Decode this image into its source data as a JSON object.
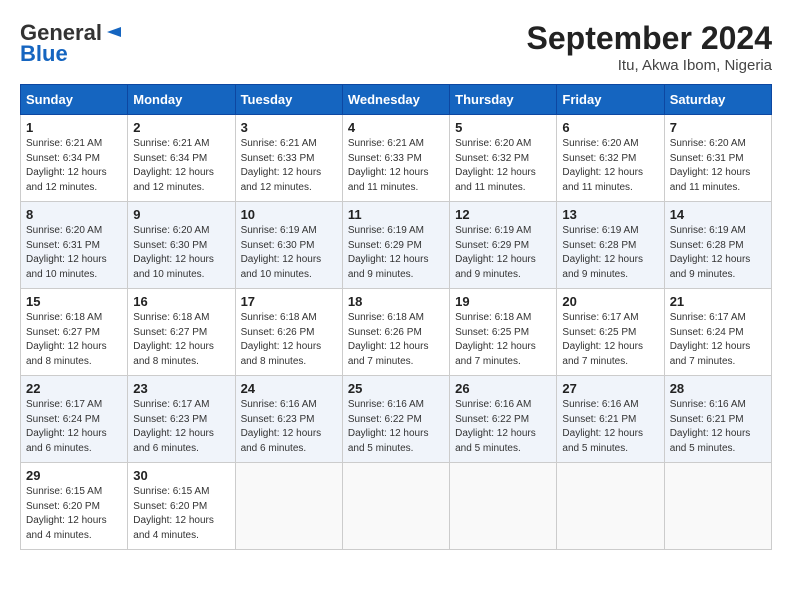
{
  "logo": {
    "line1": "General",
    "line2": "Blue"
  },
  "title": "September 2024",
  "location": "Itu, Akwa Ibom, Nigeria",
  "days_of_week": [
    "Sunday",
    "Monday",
    "Tuesday",
    "Wednesday",
    "Thursday",
    "Friday",
    "Saturday"
  ],
  "weeks": [
    [
      {
        "day": "1",
        "info": "Sunrise: 6:21 AM\nSunset: 6:34 PM\nDaylight: 12 hours\nand 12 minutes."
      },
      {
        "day": "2",
        "info": "Sunrise: 6:21 AM\nSunset: 6:34 PM\nDaylight: 12 hours\nand 12 minutes."
      },
      {
        "day": "3",
        "info": "Sunrise: 6:21 AM\nSunset: 6:33 PM\nDaylight: 12 hours\nand 12 minutes."
      },
      {
        "day": "4",
        "info": "Sunrise: 6:21 AM\nSunset: 6:33 PM\nDaylight: 12 hours\nand 11 minutes."
      },
      {
        "day": "5",
        "info": "Sunrise: 6:20 AM\nSunset: 6:32 PM\nDaylight: 12 hours\nand 11 minutes."
      },
      {
        "day": "6",
        "info": "Sunrise: 6:20 AM\nSunset: 6:32 PM\nDaylight: 12 hours\nand 11 minutes."
      },
      {
        "day": "7",
        "info": "Sunrise: 6:20 AM\nSunset: 6:31 PM\nDaylight: 12 hours\nand 11 minutes."
      }
    ],
    [
      {
        "day": "8",
        "info": "Sunrise: 6:20 AM\nSunset: 6:31 PM\nDaylight: 12 hours\nand 10 minutes."
      },
      {
        "day": "9",
        "info": "Sunrise: 6:20 AM\nSunset: 6:30 PM\nDaylight: 12 hours\nand 10 minutes."
      },
      {
        "day": "10",
        "info": "Sunrise: 6:19 AM\nSunset: 6:30 PM\nDaylight: 12 hours\nand 10 minutes."
      },
      {
        "day": "11",
        "info": "Sunrise: 6:19 AM\nSunset: 6:29 PM\nDaylight: 12 hours\nand 9 minutes."
      },
      {
        "day": "12",
        "info": "Sunrise: 6:19 AM\nSunset: 6:29 PM\nDaylight: 12 hours\nand 9 minutes."
      },
      {
        "day": "13",
        "info": "Sunrise: 6:19 AM\nSunset: 6:28 PM\nDaylight: 12 hours\nand 9 minutes."
      },
      {
        "day": "14",
        "info": "Sunrise: 6:19 AM\nSunset: 6:28 PM\nDaylight: 12 hours\nand 9 minutes."
      }
    ],
    [
      {
        "day": "15",
        "info": "Sunrise: 6:18 AM\nSunset: 6:27 PM\nDaylight: 12 hours\nand 8 minutes."
      },
      {
        "day": "16",
        "info": "Sunrise: 6:18 AM\nSunset: 6:27 PM\nDaylight: 12 hours\nand 8 minutes."
      },
      {
        "day": "17",
        "info": "Sunrise: 6:18 AM\nSunset: 6:26 PM\nDaylight: 12 hours\nand 8 minutes."
      },
      {
        "day": "18",
        "info": "Sunrise: 6:18 AM\nSunset: 6:26 PM\nDaylight: 12 hours\nand 7 minutes."
      },
      {
        "day": "19",
        "info": "Sunrise: 6:18 AM\nSunset: 6:25 PM\nDaylight: 12 hours\nand 7 minutes."
      },
      {
        "day": "20",
        "info": "Sunrise: 6:17 AM\nSunset: 6:25 PM\nDaylight: 12 hours\nand 7 minutes."
      },
      {
        "day": "21",
        "info": "Sunrise: 6:17 AM\nSunset: 6:24 PM\nDaylight: 12 hours\nand 7 minutes."
      }
    ],
    [
      {
        "day": "22",
        "info": "Sunrise: 6:17 AM\nSunset: 6:24 PM\nDaylight: 12 hours\nand 6 minutes."
      },
      {
        "day": "23",
        "info": "Sunrise: 6:17 AM\nSunset: 6:23 PM\nDaylight: 12 hours\nand 6 minutes."
      },
      {
        "day": "24",
        "info": "Sunrise: 6:16 AM\nSunset: 6:23 PM\nDaylight: 12 hours\nand 6 minutes."
      },
      {
        "day": "25",
        "info": "Sunrise: 6:16 AM\nSunset: 6:22 PM\nDaylight: 12 hours\nand 5 minutes."
      },
      {
        "day": "26",
        "info": "Sunrise: 6:16 AM\nSunset: 6:22 PM\nDaylight: 12 hours\nand 5 minutes."
      },
      {
        "day": "27",
        "info": "Sunrise: 6:16 AM\nSunset: 6:21 PM\nDaylight: 12 hours\nand 5 minutes."
      },
      {
        "day": "28",
        "info": "Sunrise: 6:16 AM\nSunset: 6:21 PM\nDaylight: 12 hours\nand 5 minutes."
      }
    ],
    [
      {
        "day": "29",
        "info": "Sunrise: 6:15 AM\nSunset: 6:20 PM\nDaylight: 12 hours\nand 4 minutes."
      },
      {
        "day": "30",
        "info": "Sunrise: 6:15 AM\nSunset: 6:20 PM\nDaylight: 12 hours\nand 4 minutes."
      },
      {
        "day": "",
        "info": ""
      },
      {
        "day": "",
        "info": ""
      },
      {
        "day": "",
        "info": ""
      },
      {
        "day": "",
        "info": ""
      },
      {
        "day": "",
        "info": ""
      }
    ]
  ]
}
